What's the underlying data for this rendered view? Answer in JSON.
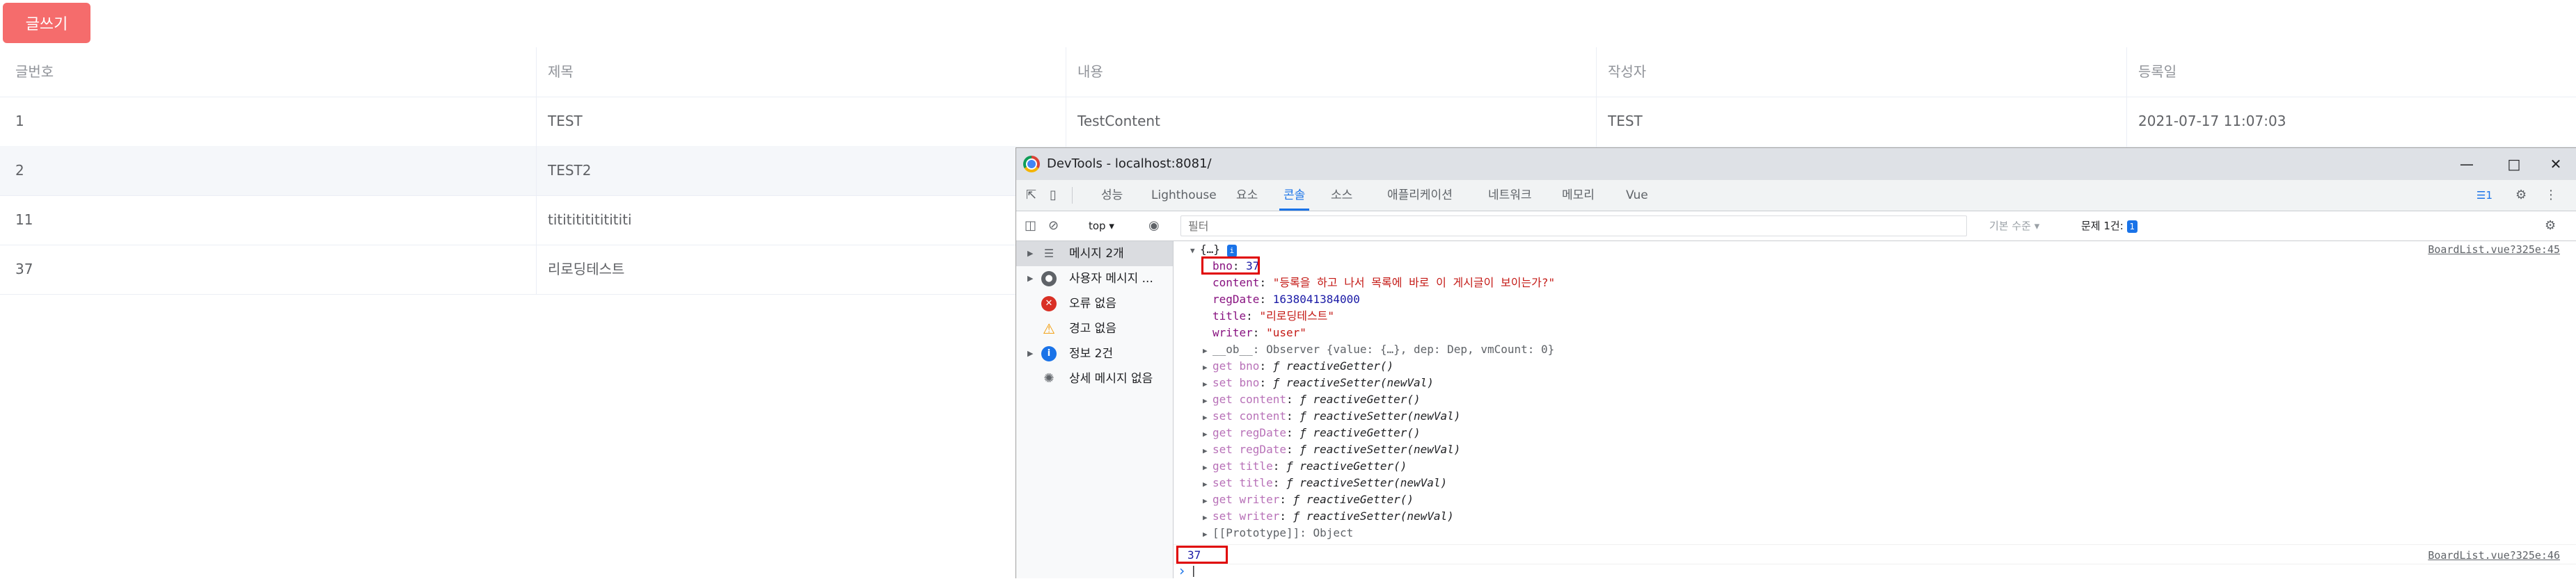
{
  "board": {
    "write_button": "글쓰기",
    "columns": [
      "글번호",
      "제목",
      "내용",
      "작성자",
      "등록일"
    ],
    "rows": [
      {
        "no": "1",
        "title": "TEST",
        "content": "TestContent",
        "writer": "TEST",
        "date": "2021-07-17 11:07:03"
      },
      {
        "no": "2",
        "title": "TEST2",
        "content": "",
        "writer": "",
        "date": ""
      },
      {
        "no": "11",
        "title": "tititititititititi",
        "content": "",
        "writer": "",
        "date": ""
      },
      {
        "no": "37",
        "title": "리로딩테스트",
        "content": "",
        "writer": "",
        "date": ""
      }
    ]
  },
  "devtools": {
    "title": "DevTools - localhost:8081/",
    "tabs": [
      "성능",
      "Lighthouse",
      "요소",
      "콘솔",
      "소스",
      "애플리케이션",
      "네트워크",
      "메모리",
      "Vue"
    ],
    "active_tab": "콘솔",
    "issue_badge": "1",
    "toolbar": {
      "context": "top",
      "filter_placeholder": "필터",
      "level": "기본 수준",
      "issues": "문제 1건:",
      "issues_count": "1"
    },
    "sidebar": [
      {
        "label": "메시지 2개",
        "icon": "list-icon"
      },
      {
        "label": "사용자 메시지 ...",
        "icon": "user-icon"
      },
      {
        "label": "오류 없음",
        "icon": "error-icon"
      },
      {
        "label": "경고 없음",
        "icon": "warning-icon"
      },
      {
        "label": "정보 2건",
        "icon": "info-icon"
      },
      {
        "label": "상세 메시지 없음",
        "icon": "bug-icon"
      }
    ],
    "console": {
      "object_head": "{…}",
      "source_1": "BoardList.vue?325e:45",
      "props": [
        {
          "key": "bno",
          "value": "37",
          "kind": "num"
        },
        {
          "key": "content",
          "value": "\"등록을 하고 나서 목록에 바로 이 게시글이 보이는가?\"",
          "kind": "str"
        },
        {
          "key": "regDate",
          "value": "1638041384000",
          "kind": "num"
        },
        {
          "key": "title",
          "value": "\"리로딩테스트\"",
          "kind": "str"
        },
        {
          "key": "writer",
          "value": "\"user\"",
          "kind": "str"
        }
      ],
      "ob_line": "__ob__: Observer {value: {…}, dep: Dep, vmCount: 0}",
      "accessors": [
        {
          "key": "get bno",
          "value": "ƒ reactiveGetter()"
        },
        {
          "key": "set bno",
          "value": "ƒ reactiveSetter(newVal)"
        },
        {
          "key": "get content",
          "value": "ƒ reactiveGetter()"
        },
        {
          "key": "set content",
          "value": "ƒ reactiveSetter(newVal)"
        },
        {
          "key": "get regDate",
          "value": "ƒ reactiveGetter()"
        },
        {
          "key": "set regDate",
          "value": "ƒ reactiveSetter(newVal)"
        },
        {
          "key": "get title",
          "value": "ƒ reactiveGetter()"
        },
        {
          "key": "set title",
          "value": "ƒ reactiveSetter(newVal)"
        },
        {
          "key": "get writer",
          "value": "ƒ reactiveGetter()"
        },
        {
          "key": "set writer",
          "value": "ƒ reactiveSetter(newVal)"
        }
      ],
      "prototype": "[[Prototype]]: Object",
      "log_value": "37",
      "source_2": "BoardList.vue?325e:46",
      "prompt": "›"
    }
  }
}
